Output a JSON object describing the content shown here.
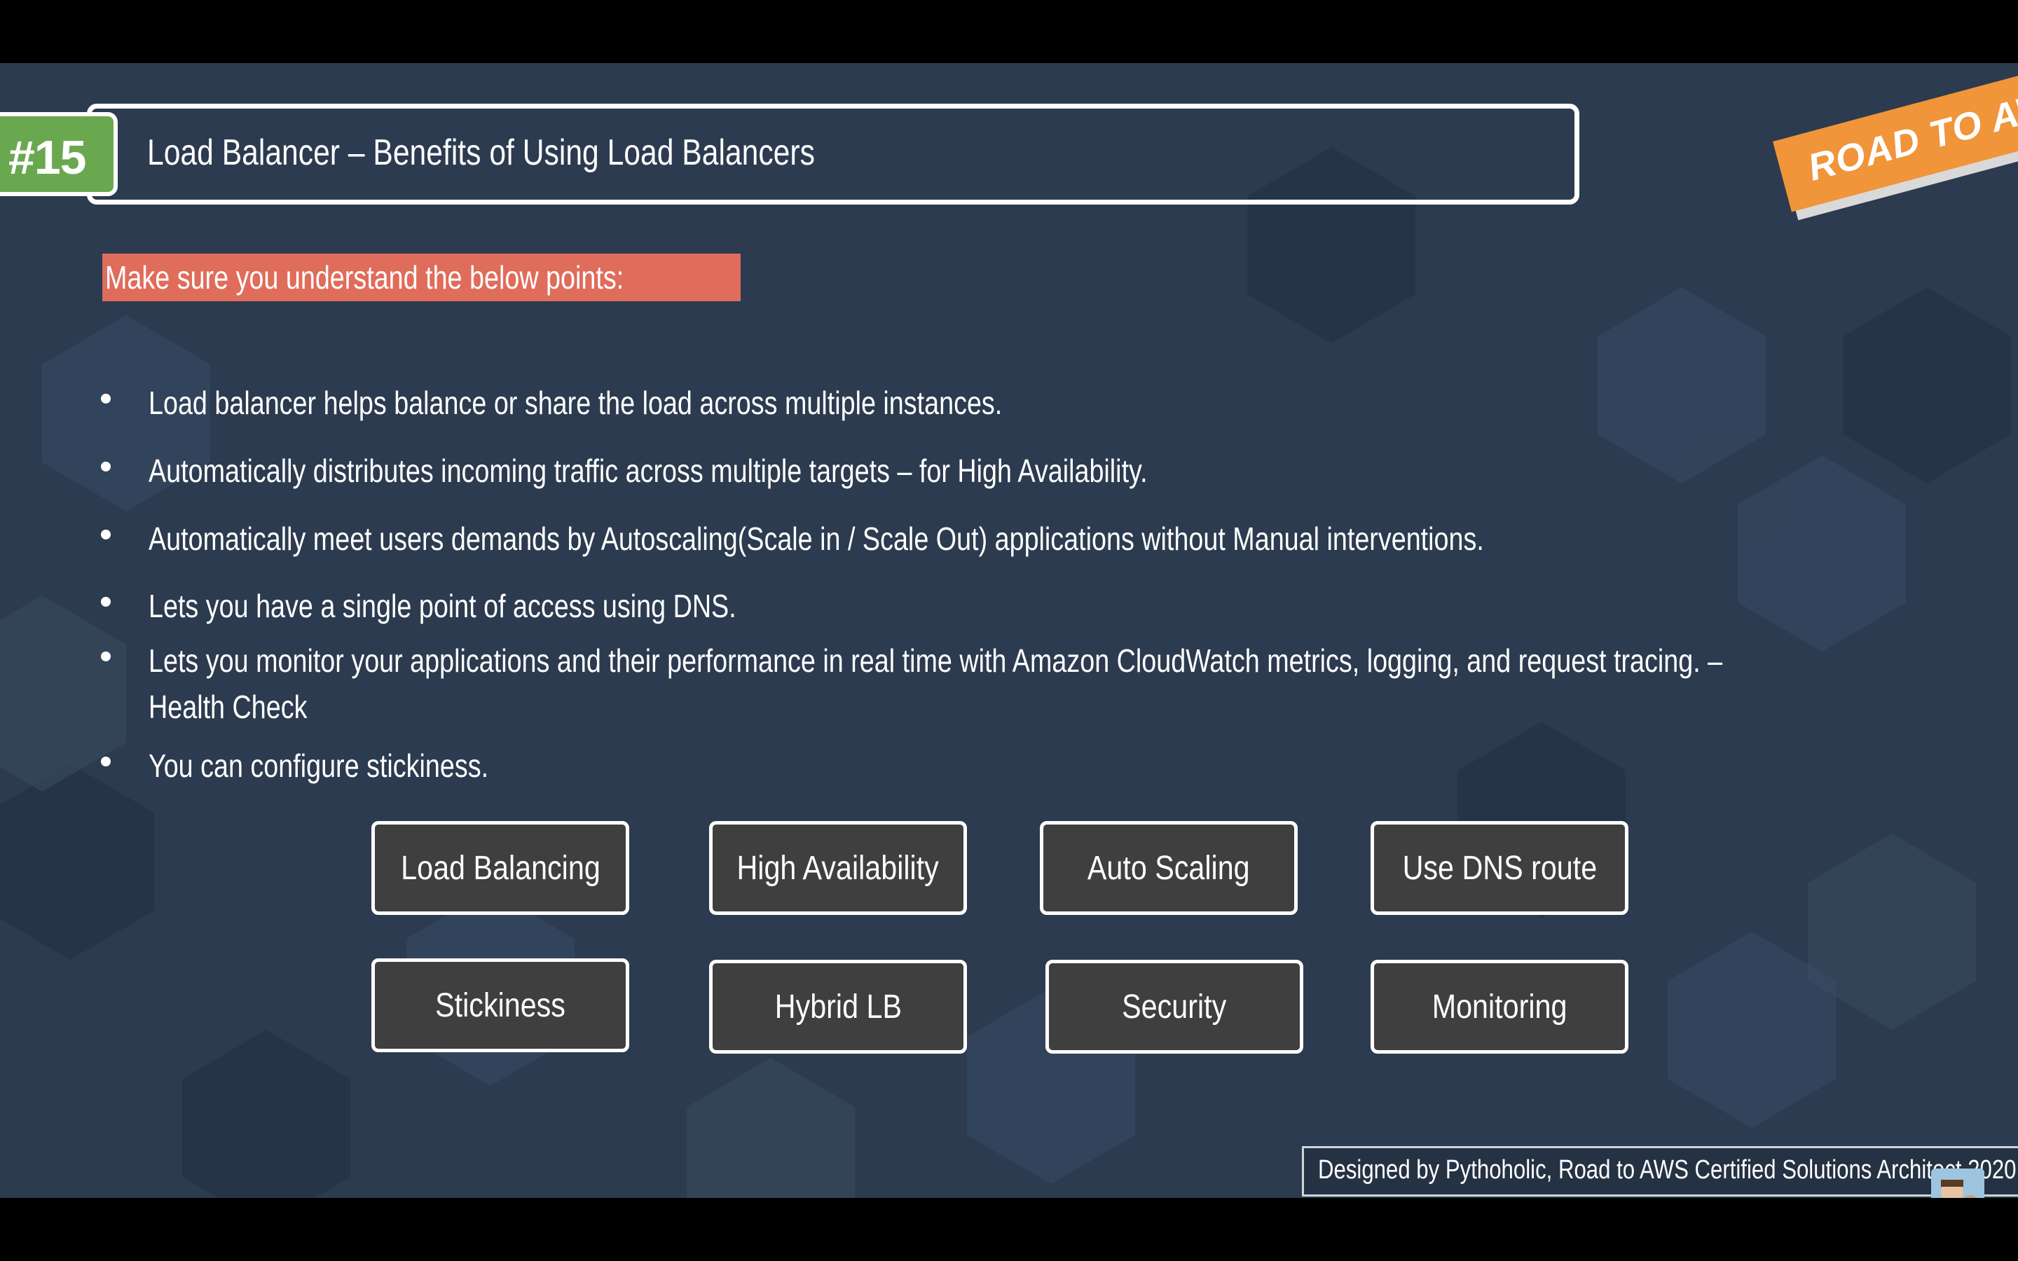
{
  "header": {
    "badge": "#15",
    "title": "Load Balancer – Benefits of Using Load Balancers",
    "ribbon": "ROAD TO AWS"
  },
  "highlight": "Make sure you understand the below points:",
  "bullets": [
    "Load balancer helps balance or share the load across multiple instances.",
    "Automatically distributes incoming traffic across multiple targets – for High Availability.",
    "Automatically meet users demands by Autoscaling(Scale in / Scale Out) applications without Manual interventions.",
    "Lets you have a single point of access using DNS.",
    "Lets you monitor your applications and their performance in real time with Amazon CloudWatch metrics, logging, and request tracing. –",
    "Health Check",
    "You can configure stickiness."
  ],
  "keywords": [
    "Load Balancing",
    "High Availability",
    "Auto Scaling",
    "Use DNS route",
    "Stickiness",
    "Hybrid LB",
    "Security",
    "Monitoring"
  ],
  "footer": "Designed by Pythoholic, Road to AWS Certified Solutions Architect 2020",
  "colors": {
    "background": "#2c3b4f",
    "badge": "#6aa84f",
    "highlight": "#e06c5b",
    "ribbon": "#f0953a",
    "pill": "#3f3f3f"
  }
}
